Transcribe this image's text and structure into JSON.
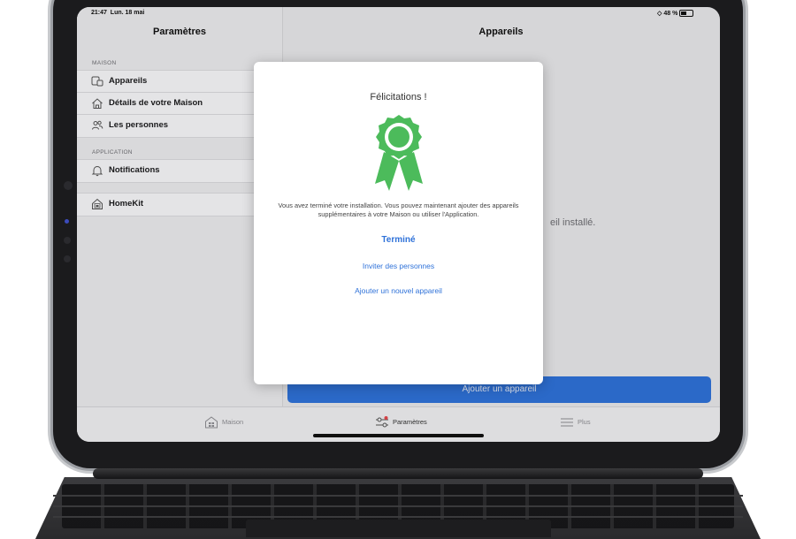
{
  "status_bar": {
    "time": "21:47",
    "date": "Lun. 18 mai",
    "battery": "48 %"
  },
  "sidebar": {
    "title": "Paramètres",
    "section_home": "MAISON",
    "section_app": "APPLICATION",
    "items": [
      {
        "label": "Appareils",
        "icon": "devices-icon"
      },
      {
        "label": "Détails de votre Maison",
        "icon": "house-icon"
      },
      {
        "label": "Les personnes",
        "icon": "people-icon"
      },
      {
        "label": "Notifications",
        "icon": "bell-icon"
      },
      {
        "label": "HomeKit",
        "icon": "homekit-icon"
      }
    ]
  },
  "main": {
    "title": "Appareils",
    "background_text": "eil installé.",
    "add_button": "Ajouter un appareil"
  },
  "tabbar": {
    "tabs": [
      {
        "label": "Maison",
        "icon": "home-grid-icon"
      },
      {
        "label": "Paramètres",
        "icon": "sliders-icon"
      },
      {
        "label": "Plus",
        "icon": "menu-icon"
      }
    ]
  },
  "modal": {
    "title": "Félicitations !",
    "icon": "award-ribbon-icon",
    "message": "Vous avez terminé votre installation. Vous pouvez maintenant ajouter des appareils supplémentaires à votre Maison ou utiliser l'Application.",
    "done": "Terminé",
    "invite": "Inviter des personnes",
    "add_device": "Ajouter un nouvel appareil"
  },
  "colors": {
    "accent": "#2f72d9",
    "award": "#4cbb5b",
    "badge": "#e5484d"
  }
}
